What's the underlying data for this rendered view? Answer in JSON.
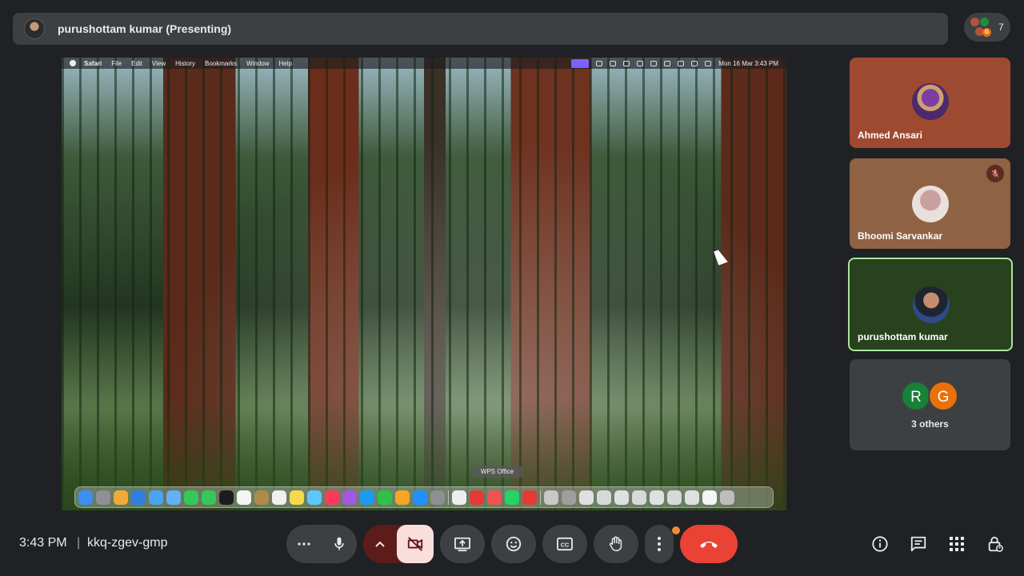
{
  "presenter": {
    "label": "purushottam kumar (Presenting)"
  },
  "participants": {
    "count": "7",
    "mini_avatar_letters": [
      "G"
    ]
  },
  "shared_screen": {
    "menubar": {
      "app": "Safari",
      "items": [
        "File",
        "Edit",
        "View",
        "History",
        "Bookmarks",
        "Window",
        "Help"
      ],
      "clock": "Mon 16 Mar  3:43 PM"
    },
    "dock_tooltip": "WPS Office"
  },
  "tiles": [
    {
      "name": "Ahmed Ansari",
      "muted": false
    },
    {
      "name": "Bhoomi Sarvankar",
      "muted": true
    },
    {
      "name": "purushottam kumar",
      "muted": false,
      "speaking": true
    },
    {
      "name": "3 others",
      "avatars": [
        "R",
        "G"
      ]
    }
  ],
  "bottom": {
    "time": "3:43 PM",
    "separator": "|",
    "meeting_code": "kkq-zgev-gmp"
  },
  "colors": {
    "background": "#202124",
    "surface": "#3c4043",
    "end_call": "#ea4335",
    "camera_off": "#f9dedc",
    "speaking_border": "#a8e69c",
    "avatar_r": "#188038",
    "avatar_g": "#e8710a"
  },
  "icons": [
    "more-options-icon",
    "microphone-icon",
    "chevron-up-icon",
    "camera-off-icon",
    "present-screen-icon",
    "emoji-icon",
    "captions-icon",
    "raise-hand-icon",
    "more-vert-icon",
    "end-call-icon",
    "info-icon",
    "chat-icon",
    "apps-icon",
    "host-controls-icon"
  ]
}
